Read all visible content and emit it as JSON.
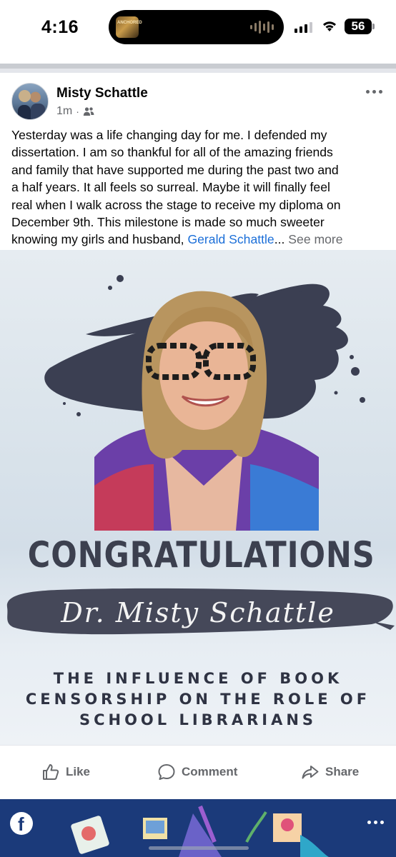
{
  "status_bar": {
    "time": "4:16",
    "battery": "56",
    "now_playing_art_text": "ANCHORED"
  },
  "post": {
    "author": "Misty Schattle",
    "timestamp": "1m",
    "separator": "·",
    "audience_icon": "friends-icon",
    "more_icon": "more-horizontal-icon",
    "text_lines": [
      "Yesterday was a life changing day for me. I defended my",
      "dissertation. I am so thankful for all of the amazing friends",
      "and family that have supported me during the past two and",
      "a half years. It all feels so surreal. Maybe it will finally feel",
      "real when I walk across the stage to receive my diploma on",
      "December 9th. This milestone is made so much sweeter"
    ],
    "last_line_prefix": "knowing my girls and husband, ",
    "mention": "Gerald Schattle",
    "ellipsis": "...",
    "see_more": "See more"
  },
  "image": {
    "headline": "CONGRATULATIONS",
    "name": "Dr. Misty Schattle",
    "thesis_lines": [
      "THE INFLUENCE OF BOOK",
      "CENSORSHIP ON THE ROLE OF",
      "SCHOOL LIBRARIANS"
    ],
    "colors": {
      "text_dark": "#3c404f",
      "brush": "#3b3f52",
      "background": "#dce5ec"
    }
  },
  "actions": {
    "like": "Like",
    "comment": "Comment",
    "share": "Share"
  },
  "colors": {
    "link": "#1a6ed8",
    "secondary_text": "#65676b",
    "next_post_bg": "#1b3a7a"
  }
}
